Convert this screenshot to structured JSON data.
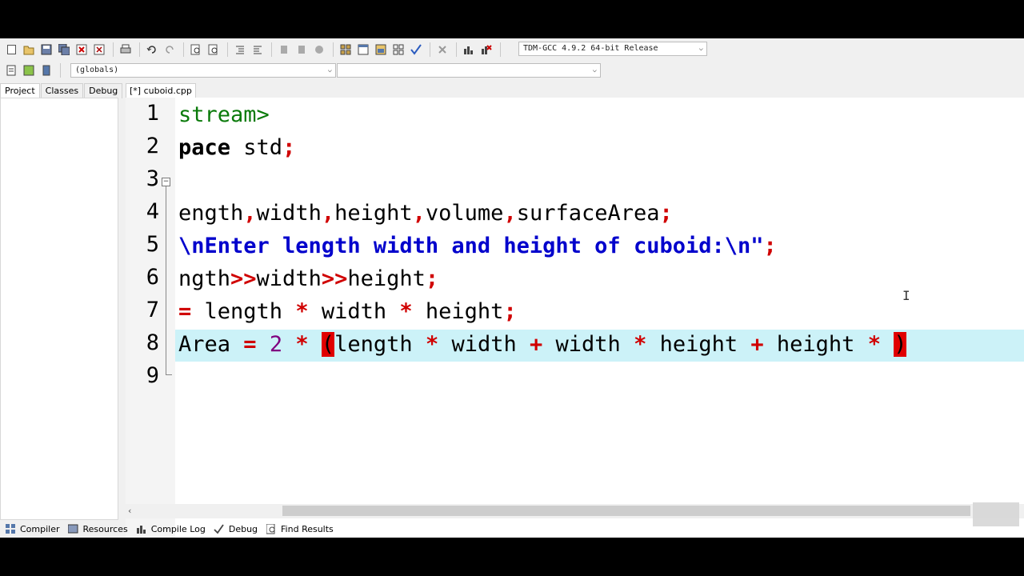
{
  "toolbar": {
    "compiler_selected": "TDM-GCC 4.9.2 64-bit Release",
    "scope_selected": "(globals)",
    "function_selected": ""
  },
  "left_tabs": [
    "Project",
    "Classes",
    "Debug"
  ],
  "editor": {
    "file_tab": "[*] cuboid.cpp",
    "line_numbers": [
      "1",
      "2",
      "3",
      "4",
      "5",
      "6",
      "7",
      "8",
      "9"
    ]
  },
  "code": {
    "line1": "stream>",
    "line2_kw": "pace",
    "line2_rest": " std",
    "line2_semi": ";",
    "line4_a": "ength",
    "line4_c1": ",",
    "line4_b": "width",
    "line4_c2": ",",
    "line4_c": "height",
    "line4_c3": ",",
    "line4_d": "volume",
    "line4_c4": ",",
    "line4_e": "surfaceArea",
    "line4_semi": ";",
    "line5_str": "\\nEnter length width and height of cuboid:\\n\"",
    "line5_semi": ";",
    "line6_a": "ngth",
    "line6_op1": ">>",
    "line6_b": "width",
    "line6_op2": ">>",
    "line6_c": "height",
    "line6_semi": ";",
    "line7_eq": "=",
    "line7_a": " length ",
    "line7_op1": "*",
    "line7_b": " width ",
    "line7_op2": "*",
    "line7_c": " height",
    "line7_semi": ";",
    "line8_a": "Area ",
    "line8_eq": "=",
    "line8_sp1": " ",
    "line8_num": "2",
    "line8_sp2": " ",
    "line8_op1": "*",
    "line8_sp3": " ",
    "line8_lp": "(",
    "line8_b": "length ",
    "line8_op2": "*",
    "line8_c": " width ",
    "line8_op3": "+",
    "line8_d": " width ",
    "line8_op4": "*",
    "line8_e": " height ",
    "line8_op5": "+",
    "line8_f": " height ",
    "line8_op6": "*",
    "line8_sp4": " ",
    "line8_rp": ")"
  },
  "bottom_tabs": [
    "Compiler",
    "Resources",
    "Compile Log",
    "Debug",
    "Find Results"
  ],
  "colors": {
    "highlight": "#ccf2f8",
    "bracket_match": "#e00000",
    "symbol": "#d00000",
    "string": "#0000cc",
    "number": "#800080",
    "preprocessor": "#0a7a0a"
  }
}
